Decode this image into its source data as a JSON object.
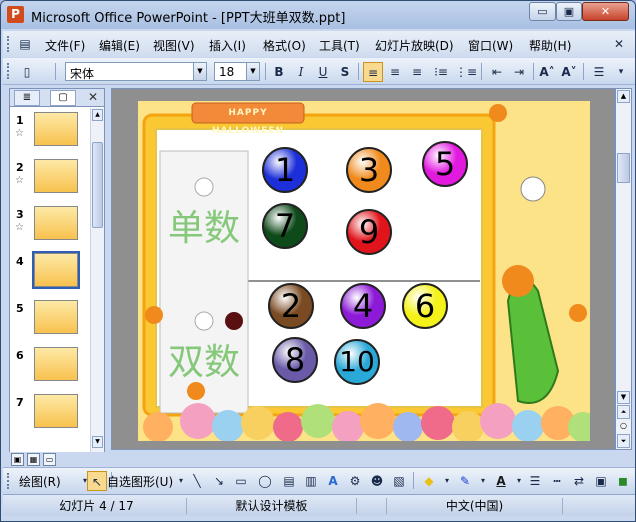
{
  "window": {
    "app_icon": "powerpoint-icon",
    "title": "Microsoft Office PowerPoint - [PPT大班单双数.ppt]",
    "minimize_label": "▭",
    "maximize_label": "▣",
    "close_label": "✕"
  },
  "menu": {
    "items": [
      "文件(F)",
      "编辑(E)",
      "视图(V)",
      "插入(I)",
      "格式(O)",
      "工具(T)",
      "幻灯片放映(D)",
      "窗口(W)",
      "帮助(H)"
    ]
  },
  "format_toolbar": {
    "font": "宋体",
    "size": "18",
    "bold": "B",
    "italic": "I",
    "underline": "U",
    "shadow": "S",
    "grow_font": "A˄",
    "shrink_font": "A˅"
  },
  "left_pane": {
    "tab_outline_icon": "outline-icon",
    "tab_slides_icon": "slides-icon",
    "close_label": "✕",
    "thumbnails": [
      {
        "num": "1",
        "star": "☆"
      },
      {
        "num": "2",
        "star": "☆"
      },
      {
        "num": "3",
        "star": "☆"
      },
      {
        "num": "4",
        "star": ""
      },
      {
        "num": "5",
        "star": ""
      },
      {
        "num": "6",
        "star": ""
      },
      {
        "num": "7",
        "star": ""
      }
    ],
    "selected": "4"
  },
  "slide": {
    "banner": "HAPPY HALLOWEEN",
    "odd_label": "单数",
    "even_label": "双数",
    "odd_balls": [
      {
        "n": "1",
        "color": "#1c2fd8"
      },
      {
        "n": "3",
        "color": "#f08a1c"
      },
      {
        "n": "5",
        "color": "#e21ae0"
      },
      {
        "n": "7",
        "color": "#0e4a1a"
      },
      {
        "n": "9",
        "color": "#e0141a"
      }
    ],
    "even_balls": [
      {
        "n": "2",
        "color": "#7a4a22"
      },
      {
        "n": "4",
        "color": "#8c1ad6"
      },
      {
        "n": "6",
        "color": "#f4f21a"
      },
      {
        "n": "8",
        "color": "#6a5aa8"
      },
      {
        "n": "10",
        "color": "#2aa8d8"
      }
    ]
  },
  "drawing_toolbar": {
    "draw_label": "绘图(R)",
    "autoshape_label": "自选图形(U)"
  },
  "status": {
    "slide": "幻灯片 4 / 17",
    "design": "默认设计模板",
    "language": "中文(中国)"
  }
}
